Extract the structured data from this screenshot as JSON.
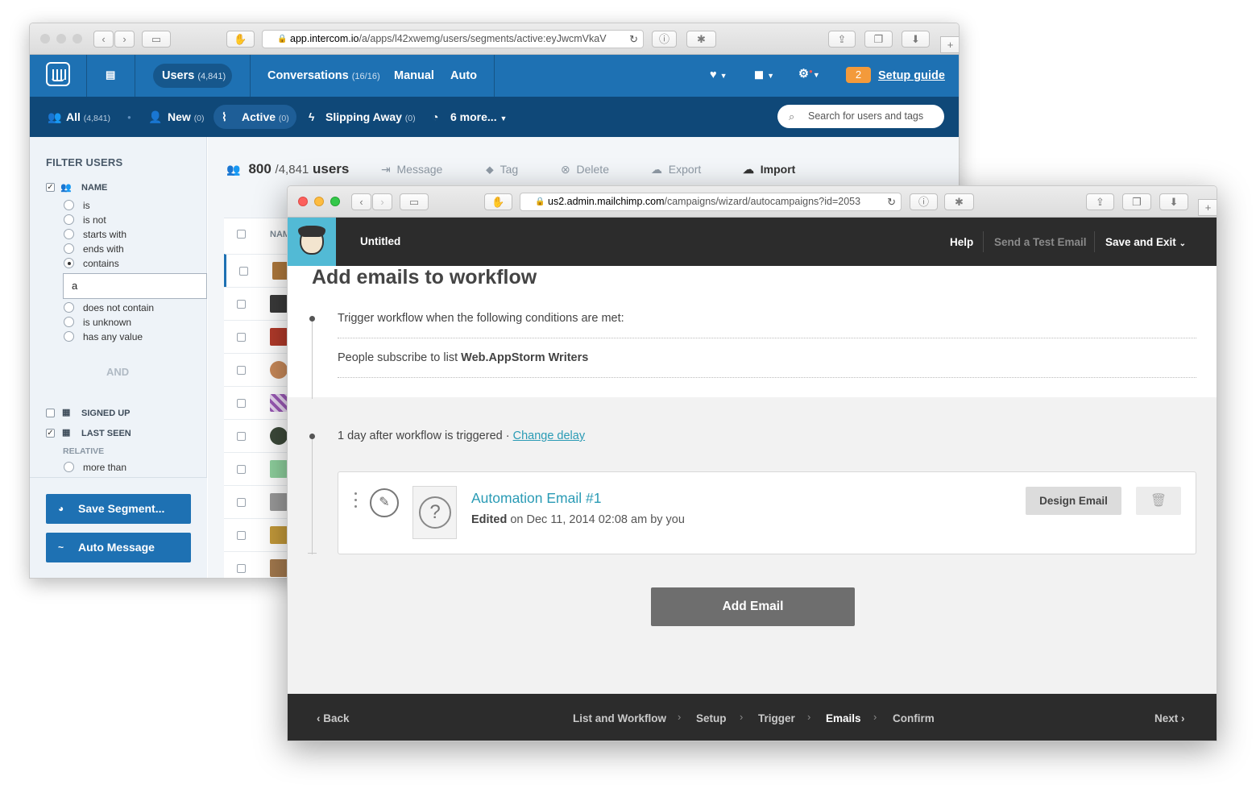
{
  "intercom": {
    "url": {
      "host": "app.intercom.io",
      "path": "/a/apps/l42xwemg/users/segments/active:eyJwcmVkaV"
    },
    "nav": {
      "users_label": "Users",
      "users_count": "(4,841)",
      "conversations_label": "Conversations",
      "conversations_count": "(16/16)",
      "manual_label": "Manual",
      "auto_label": "Auto",
      "setup_badge": "2",
      "setup_label": "Setup guide"
    },
    "subnav": {
      "all_label": "All",
      "all_count": "(4,841)",
      "new_label": "New",
      "new_count": "(0)",
      "active_label": "Active",
      "active_count": "(0)",
      "slipping_label": "Slipping Away",
      "slipping_count": "(0)",
      "more_label": "6 more...",
      "search_placeholder": "Search for users and tags"
    },
    "sidebar": {
      "title": "FILTER USERS",
      "name_heading": "NAME",
      "options": [
        "is",
        "is not",
        "starts with",
        "ends with",
        "contains"
      ],
      "input_value": "a",
      "options_after": [
        "does not contain",
        "is unknown",
        "has any value"
      ],
      "and_label": "AND",
      "signed_up": "SIGNED UP",
      "last_seen": "LAST SEEN",
      "relative": "RELATIVE",
      "more_than": "more than",
      "save_segment": "Save Segment...",
      "auto_message": "Auto Message"
    },
    "main": {
      "count_bold": "800",
      "count_total": "/4,841",
      "count_unit": "users",
      "message": "Message",
      "tag": "Tag",
      "delete": "Delete",
      "export": "Export",
      "import": "Import",
      "col_name": "NAM"
    }
  },
  "mailchimp": {
    "url": {
      "host": "us2.admin.mailchimp.com",
      "path": "/campaigns/wizard/autocampaigns?id=2053"
    },
    "header": {
      "title": "Untitled",
      "help": "Help",
      "send_test": "Send a Test Email",
      "save_exit": "Save and Exit"
    },
    "body": {
      "heading": "Add emails to workflow",
      "trigger_text": "Trigger workflow when the following conditions are met:",
      "subscribe_prefix": "People subscribe to list",
      "subscribe_list": "Web.AppStorm Writers",
      "delay_text": "1 day after workflow is triggered ·",
      "change_delay": "Change delay",
      "email_title": "Automation Email #1",
      "edited_label": "Edited",
      "edited_detail": "on Dec 11, 2014 02:08 am by you",
      "design_email": "Design Email",
      "add_email": "Add Email"
    },
    "footer": {
      "back": "Back",
      "steps": [
        "List and Workflow",
        "Setup",
        "Trigger",
        "Emails",
        "Confirm"
      ],
      "next": "Next"
    },
    "colors": {
      "accent": "#52bad5",
      "link": "#2a9bb5",
      "dark": "#2c2c2c"
    }
  },
  "colors": {
    "intercom_blue": "#1e71b3",
    "intercom_dark": "#0f4878",
    "badge": "#f39a3b"
  }
}
